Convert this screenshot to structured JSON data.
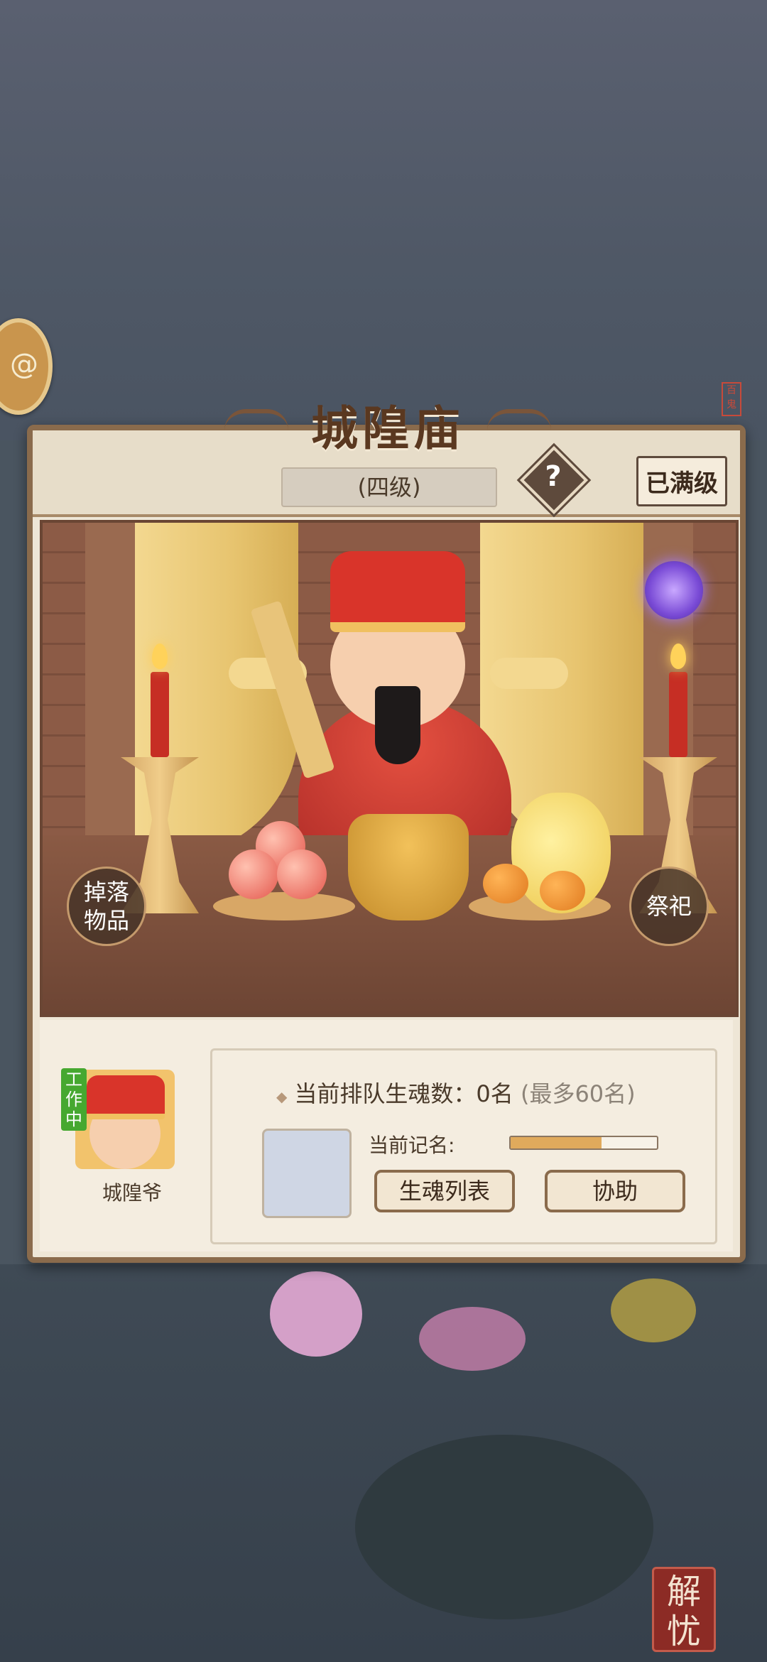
{
  "building": {
    "title": "城隍庙",
    "level": "(四级)",
    "help_symbol": "?",
    "max_level_label": "已满级"
  },
  "scene": {
    "drop_items_button": "掉落\n物品",
    "worship_button": "祭祀"
  },
  "character": {
    "status_badge": "工作中",
    "name": "城隍爷"
  },
  "queue": {
    "label": "当前排队生魂数：",
    "count": "0名",
    "max": "(最多60名)",
    "recording_label": "当前记名:",
    "recording_progress": 0.62
  },
  "buttons": {
    "soul_list": "生魂列表",
    "assist": "协助"
  },
  "corner_badge": "解忧",
  "colors": {
    "panel_bg": "#eee6d6",
    "frame": "#8a6b4c",
    "progress_fill": "#e0aa5c",
    "working_badge": "#46a830"
  }
}
